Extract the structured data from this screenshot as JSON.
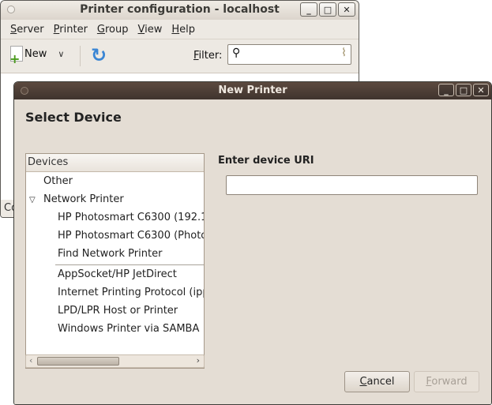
{
  "back_window": {
    "title": "Printer configuration - localhost",
    "menu": [
      {
        "label": "Server",
        "mnemonic": "S",
        "rest": "erver"
      },
      {
        "label": "Printer",
        "mnemonic": "P",
        "rest": "rinter"
      },
      {
        "label": "Group",
        "mnemonic": "G",
        "rest": "roup"
      },
      {
        "label": "View",
        "mnemonic": "V",
        "rest": "iew"
      },
      {
        "label": "Help",
        "mnemonic": "H",
        "rest": "elp"
      }
    ],
    "toolbar": {
      "new_label": "New",
      "filter_mnemonic": "F",
      "filter_rest": "ilter:",
      "filter_value": ""
    },
    "status_text": "Co"
  },
  "dialog": {
    "title": "New Printer",
    "heading": "Select Device",
    "devices_header": "Devices",
    "devices": {
      "other": "Other",
      "network_printer": "Network Printer",
      "network_children": [
        "HP Photosmart C6300 (192.1",
        "HP Photosmart C6300 (Photo",
        "Find Network Printer"
      ],
      "protocols": [
        "AppSocket/HP JetDirect",
        "Internet Printing Protocol (ipp",
        "LPD/LPR Host or Printer",
        "Windows Printer via SAMBA"
      ]
    },
    "uri_label": "Enter device URI",
    "uri_value": "",
    "buttons": {
      "cancel_mnemonic": "C",
      "cancel_rest": "ancel",
      "forward_mnemonic": "F",
      "forward_rest": "orward",
      "forward_enabled": false
    }
  }
}
